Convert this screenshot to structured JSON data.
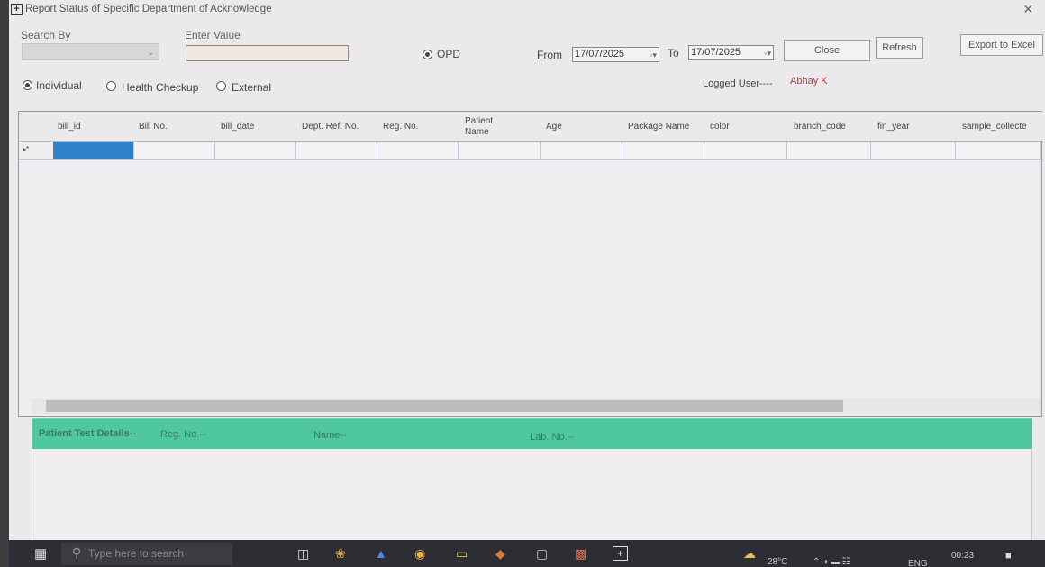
{
  "window": {
    "title": "Report Status of Specific Department of Acknowledge",
    "close_glyph": "×"
  },
  "filters": {
    "search_by_label": "Search By",
    "search_by_value": "",
    "enter_value_label": "Enter Value",
    "enter_value_value": "",
    "opd_label": "OPD",
    "from_label": "From",
    "from_date": "17/07/2025",
    "to_label": "To",
    "to_date": "17/07/2025",
    "close_button": "Close",
    "refresh_button": "Refresh",
    "export_button": "Export to Excel",
    "mode_options": [
      "Individual",
      "Health Checkup",
      "External"
    ],
    "selected_mode": "Individual",
    "logged_user_label": "Logged User----",
    "logged_user_value": "Abhay K"
  },
  "grid": {
    "row_indicator": "▸*",
    "columns": [
      "bill_id",
      "Bill No.",
      "bill_date",
      "Dept. Ref. No.",
      "Reg. No.",
      "Patient Name",
      "Age",
      "Package Name",
      "color",
      "branch_code",
      "fin_year",
      "sample_collecte"
    ]
  },
  "details_bar": {
    "title": "Patient Test Details--",
    "reg_no_label": "Reg. No.--",
    "name_label": "Name--",
    "lab_no_label": "Lab. No.--"
  },
  "taskbar": {
    "search_placeholder": "Type here to search",
    "weather": "28°C",
    "language": "ENG",
    "time": "00:23"
  },
  "colors": {
    "selection": "#2f83cd",
    "details_bar": "#4fc89d",
    "user_name": "#b23a3a"
  }
}
